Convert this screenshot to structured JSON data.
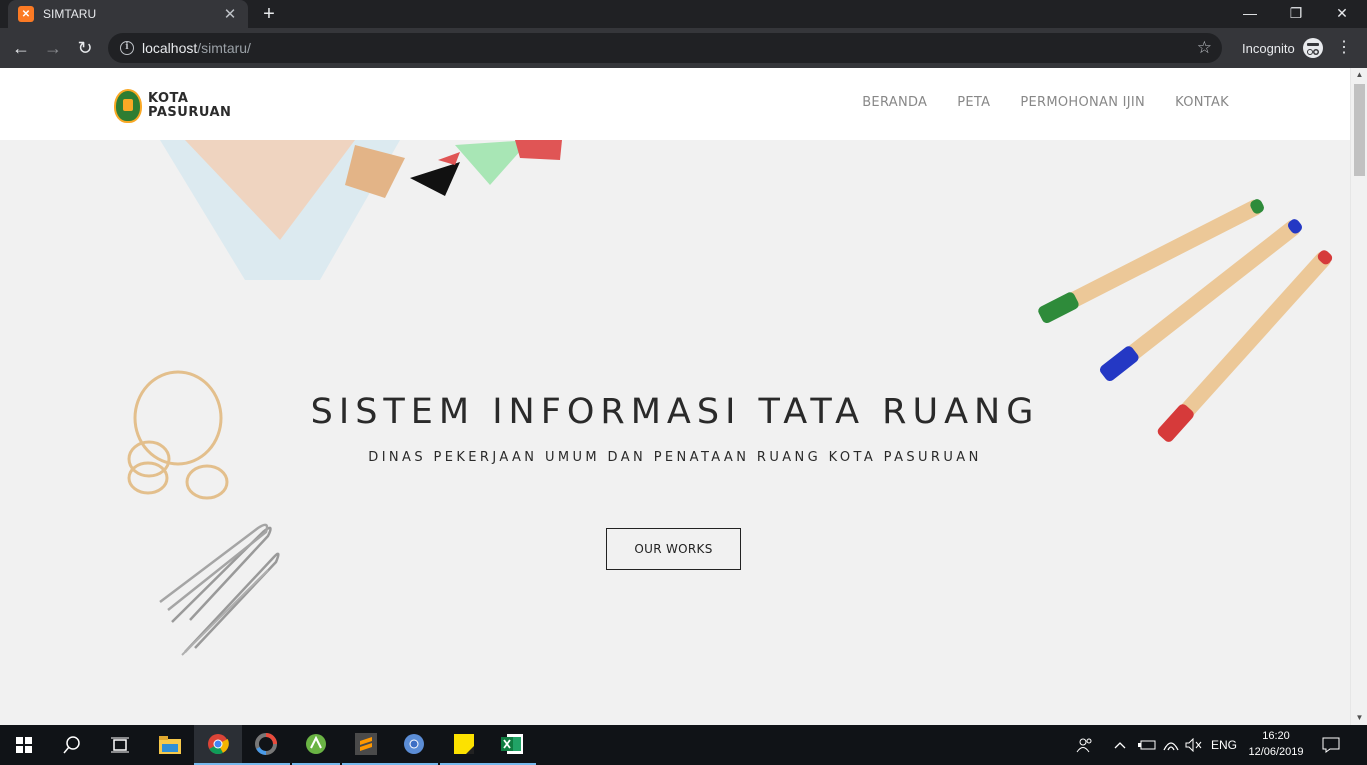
{
  "browser": {
    "tab_title": "SIMTARU",
    "tab_close": "✕",
    "new_tab": "+",
    "url_host": "localhost",
    "url_path": "/simtaru/",
    "incognito_label": "Incognito",
    "window_controls": {
      "minimize": "—",
      "restore": "❐",
      "close": "✕"
    },
    "nav": {
      "back": "←",
      "forward": "→",
      "reload": "↻"
    },
    "star": "☆",
    "menu": "⋮"
  },
  "site": {
    "logo_line1": "KOTA",
    "logo_line2": "PASURUAN",
    "nav_items": [
      "BERANDA",
      "PETA",
      "PERMOHONAN IJIN",
      "KONTAK"
    ],
    "hero_title": "SISTEM INFORMASI TATA RUANG",
    "hero_subtitle": "DINAS PEKERJAAN UMUM DAN PENATAAN RUANG KOTA PASURUAN",
    "hero_button": "OUR WORKS"
  },
  "taskbar": {
    "language": "ENG",
    "time": "16:20",
    "date": "12/06/2019",
    "apps": [
      "start",
      "search",
      "task-view",
      "file-explorer",
      "chrome",
      "davinci",
      "android-studio",
      "sublime-text",
      "chrome-alt",
      "sticky-notes",
      "excel"
    ]
  },
  "colors": {
    "accent": "#76b9ed",
    "marker_green": "#2e8b3a",
    "marker_blue": "#2438c4",
    "marker_red": "#d63a3a"
  }
}
